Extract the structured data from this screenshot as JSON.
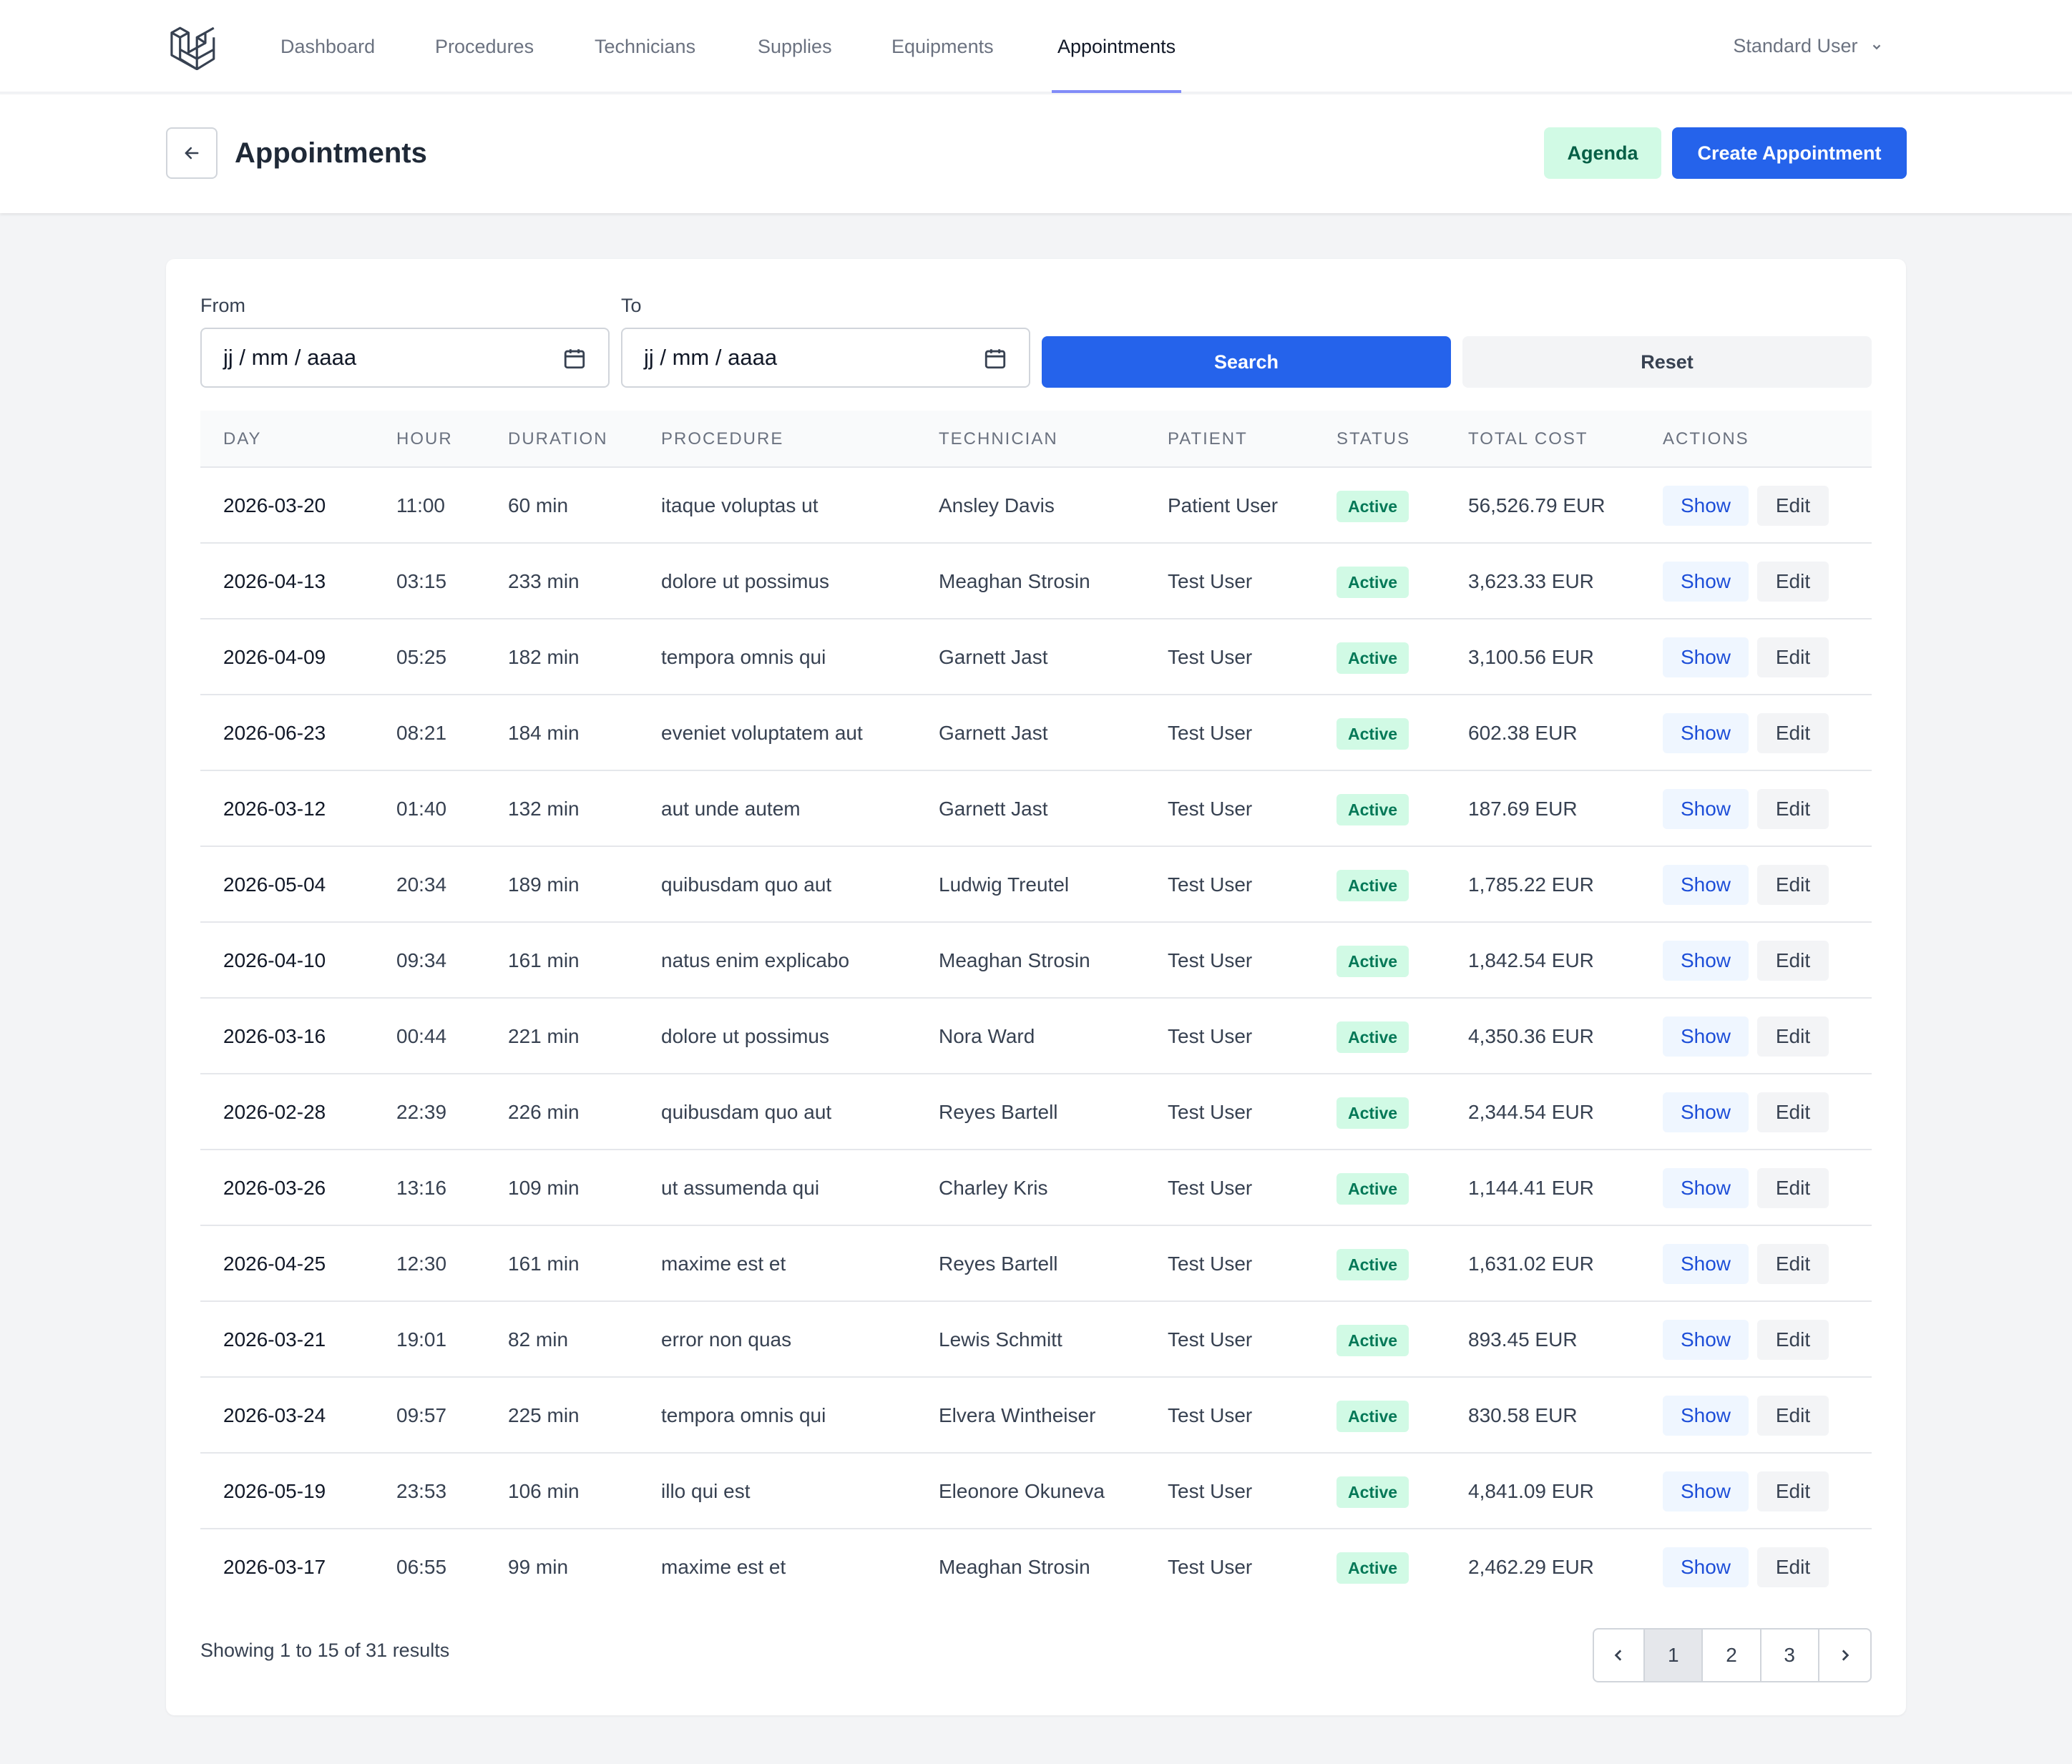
{
  "nav": {
    "items": [
      {
        "label": "Dashboard"
      },
      {
        "label": "Procedures"
      },
      {
        "label": "Technicians"
      },
      {
        "label": "Supplies"
      },
      {
        "label": "Equipments"
      },
      {
        "label": "Appointments",
        "active": true
      }
    ],
    "user": "Standard User"
  },
  "header": {
    "title": "Appointments",
    "agenda_label": "Agenda",
    "create_label": "Create Appointment"
  },
  "filters": {
    "from_label": "From",
    "to_label": "To",
    "from_value": "jj / mm / aaaa",
    "to_value": "jj / mm / aaaa",
    "search_label": "Search",
    "reset_label": "Reset"
  },
  "table": {
    "headers": [
      "DAY",
      "HOUR",
      "DURATION",
      "PROCEDURE",
      "TECHNICIAN",
      "PATIENT",
      "STATUS",
      "TOTAL COST",
      "ACTIONS"
    ],
    "show_label": "Show",
    "edit_label": "Edit",
    "rows": [
      {
        "day": "2026-03-20",
        "hour": "11:00",
        "duration": "60 min",
        "procedure": "itaque voluptas ut",
        "technician": "Ansley Davis",
        "patient": "Patient User",
        "status": "Active",
        "cost": "56,526.79 EUR"
      },
      {
        "day": "2026-04-13",
        "hour": "03:15",
        "duration": "233 min",
        "procedure": "dolore ut possimus",
        "technician": "Meaghan Strosin",
        "patient": "Test User",
        "status": "Active",
        "cost": "3,623.33 EUR"
      },
      {
        "day": "2026-04-09",
        "hour": "05:25",
        "duration": "182 min",
        "procedure": "tempora omnis qui",
        "technician": "Garnett Jast",
        "patient": "Test User",
        "status": "Active",
        "cost": "3,100.56 EUR"
      },
      {
        "day": "2026-06-23",
        "hour": "08:21",
        "duration": "184 min",
        "procedure": "eveniet voluptatem aut",
        "technician": "Garnett Jast",
        "patient": "Test User",
        "status": "Active",
        "cost": "602.38 EUR"
      },
      {
        "day": "2026-03-12",
        "hour": "01:40",
        "duration": "132 min",
        "procedure": "aut unde autem",
        "technician": "Garnett Jast",
        "patient": "Test User",
        "status": "Active",
        "cost": "187.69 EUR"
      },
      {
        "day": "2026-05-04",
        "hour": "20:34",
        "duration": "189 min",
        "procedure": "quibusdam quo aut",
        "technician": "Ludwig Treutel",
        "patient": "Test User",
        "status": "Active",
        "cost": "1,785.22 EUR"
      },
      {
        "day": "2026-04-10",
        "hour": "09:34",
        "duration": "161 min",
        "procedure": "natus enim explicabo",
        "technician": "Meaghan Strosin",
        "patient": "Test User",
        "status": "Active",
        "cost": "1,842.54 EUR"
      },
      {
        "day": "2026-03-16",
        "hour": "00:44",
        "duration": "221 min",
        "procedure": "dolore ut possimus",
        "technician": "Nora Ward",
        "patient": "Test User",
        "status": "Active",
        "cost": "4,350.36 EUR"
      },
      {
        "day": "2026-02-28",
        "hour": "22:39",
        "duration": "226 min",
        "procedure": "quibusdam quo aut",
        "technician": "Reyes Bartell",
        "patient": "Test User",
        "status": "Active",
        "cost": "2,344.54 EUR"
      },
      {
        "day": "2026-03-26",
        "hour": "13:16",
        "duration": "109 min",
        "procedure": "ut assumenda qui",
        "technician": "Charley Kris",
        "patient": "Test User",
        "status": "Active",
        "cost": "1,144.41 EUR"
      },
      {
        "day": "2026-04-25",
        "hour": "12:30",
        "duration": "161 min",
        "procedure": "maxime est et",
        "technician": "Reyes Bartell",
        "patient": "Test User",
        "status": "Active",
        "cost": "1,631.02 EUR"
      },
      {
        "day": "2026-03-21",
        "hour": "19:01",
        "duration": "82 min",
        "procedure": "error non quas",
        "technician": "Lewis Schmitt",
        "patient": "Test User",
        "status": "Active",
        "cost": "893.45 EUR"
      },
      {
        "day": "2026-03-24",
        "hour": "09:57",
        "duration": "225 min",
        "procedure": "tempora omnis qui",
        "technician": "Elvera Wintheiser",
        "patient": "Test User",
        "status": "Active",
        "cost": "830.58 EUR"
      },
      {
        "day": "2026-05-19",
        "hour": "23:53",
        "duration": "106 min",
        "procedure": "illo qui est",
        "technician": "Eleonore Okuneva",
        "patient": "Test User",
        "status": "Active",
        "cost": "4,841.09 EUR"
      },
      {
        "day": "2026-03-17",
        "hour": "06:55",
        "duration": "99 min",
        "procedure": "maxime est et",
        "technician": "Meaghan Strosin",
        "patient": "Test User",
        "status": "Active",
        "cost": "2,462.29 EUR"
      }
    ]
  },
  "pagination": {
    "summary": "Showing 1 to 15 of 31 results",
    "pages": [
      "1",
      "2",
      "3"
    ],
    "current": "1"
  },
  "colors": {
    "primary": "#2563eb",
    "agenda_bg": "#d1fae5",
    "active_badge": "#047857",
    "nav_active_underline": "#818cf8"
  },
  "icons": {
    "logo": "laravel-logo-icon",
    "back": "arrow-left-icon",
    "user_menu": "chevron-down-icon",
    "calendar": "calendar-icon",
    "prev": "chevron-left-icon",
    "next": "chevron-right-icon"
  }
}
